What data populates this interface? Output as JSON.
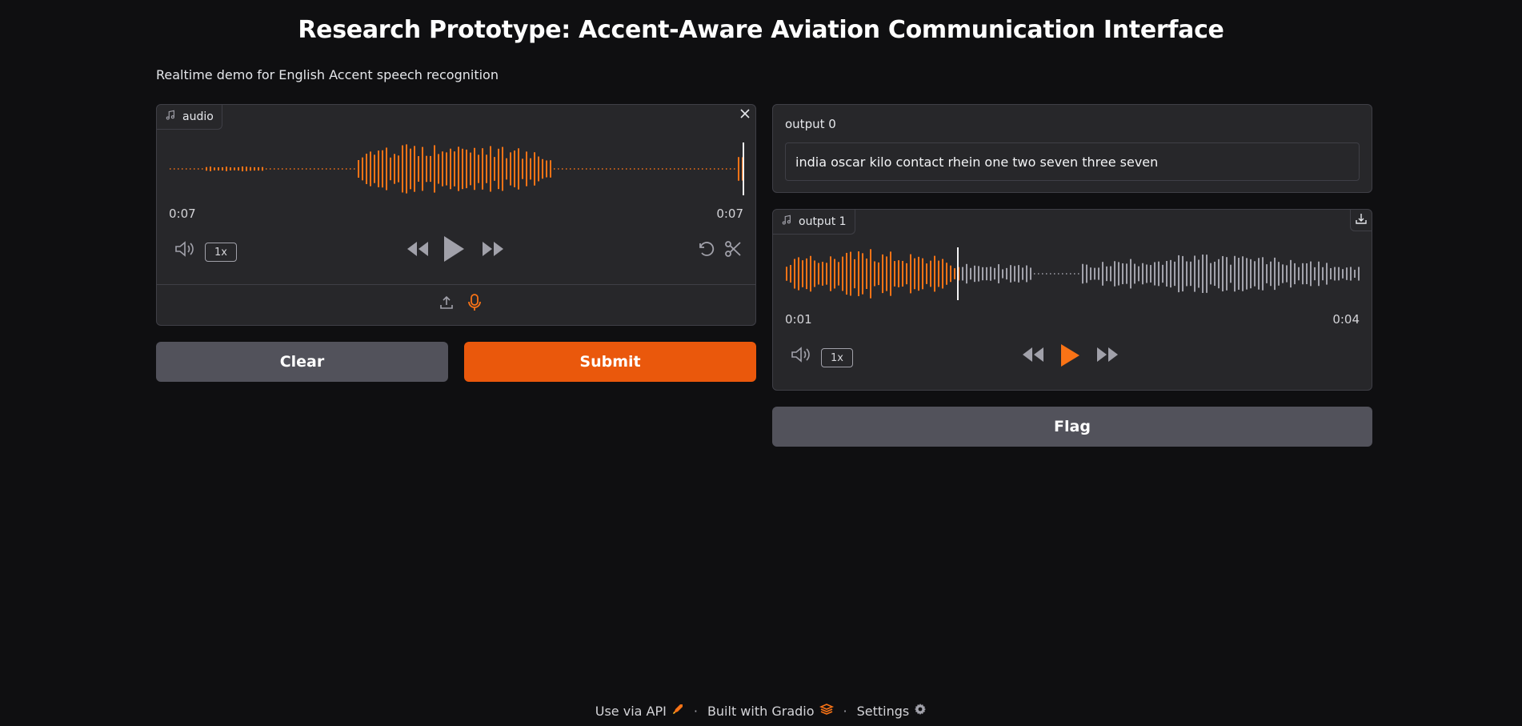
{
  "header": {
    "title": "Research Prototype: Accent-Aware Aviation Communication Interface",
    "description": "Realtime demo for English Accent speech recognition"
  },
  "input_audio": {
    "label": "audio",
    "icon": "music-note-icon",
    "time_current": "0:07",
    "time_total": "0:07",
    "speed": "1x",
    "progress": 1.0
  },
  "buttons": {
    "clear": "Clear",
    "submit": "Submit",
    "flag": "Flag"
  },
  "output0": {
    "label": "output 0",
    "value": "india oscar kilo contact rhein one two seven three seven"
  },
  "output1": {
    "label": "output 1",
    "icon": "music-note-icon",
    "time_current": "0:01",
    "time_total": "0:04",
    "speed": "1x",
    "progress": 0.3
  },
  "footer": {
    "api": "Use via API",
    "built": "Built with Gradio",
    "settings": "Settings"
  },
  "colors": {
    "accent": "#f97316",
    "button_primary": "#ea580c",
    "button_secondary": "#52525b",
    "panel": "#27272a",
    "background": "#0f0f11"
  }
}
